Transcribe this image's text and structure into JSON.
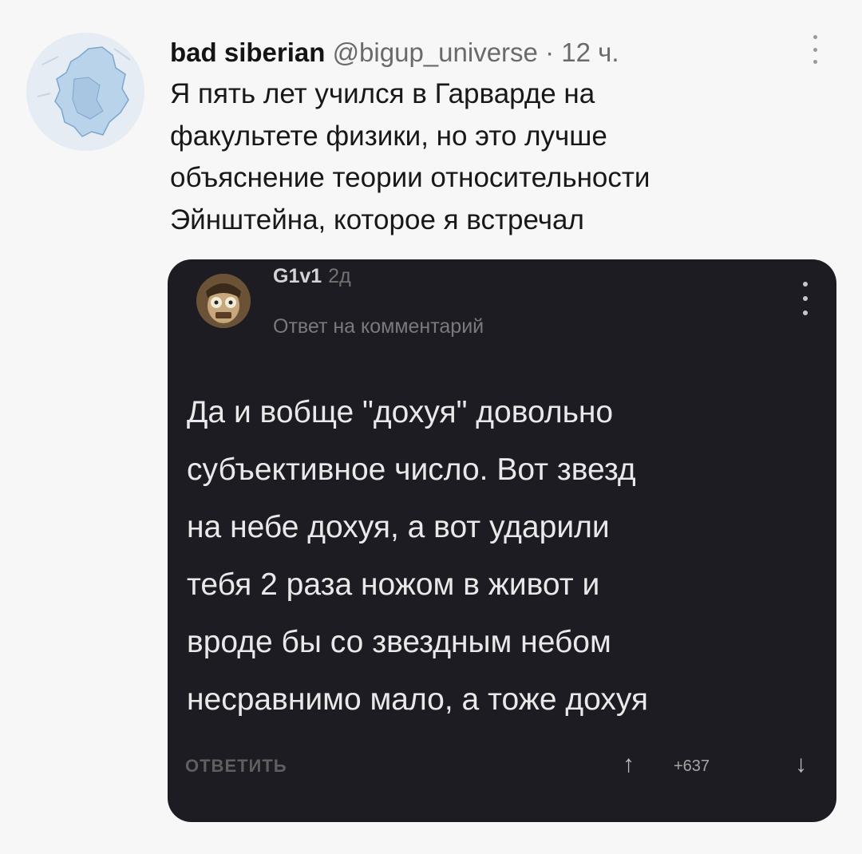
{
  "tweet": {
    "username": "bad siberian",
    "handle": "@bigup_universe",
    "separator": "·",
    "time": "12 ч.",
    "text_lines": [
      "Я пять лет учился в Гарварде на",
      "факультете физики, но это лучше",
      "объяснение теории относительности",
      "Эйнштейна, которое я встречал"
    ],
    "icons": {
      "avatar": "siberia-map-avatar",
      "more": "more-vertical-icon"
    }
  },
  "comment": {
    "author": "G1v1",
    "time": "2д",
    "reply_label": "Ответ на комментарий",
    "body_lines": [
      "Да и вобще \"дохуя\" довольно",
      "субъективное число. Вот звезд",
      "на небе дохуя, а вот ударили",
      "тебя 2 раза ножом в живот и",
      "вроде бы со звездным небом",
      "несравнимо мало, а тоже дохуя"
    ],
    "reply_button": "ОТВЕТИТЬ",
    "score": "+637",
    "icons": {
      "upvote": "arrow-up-icon",
      "downvote": "arrow-down-icon",
      "more": "more-vertical-icon"
    },
    "colors": {
      "background": "#1d1c22",
      "text": "#e9e9e9"
    }
  }
}
